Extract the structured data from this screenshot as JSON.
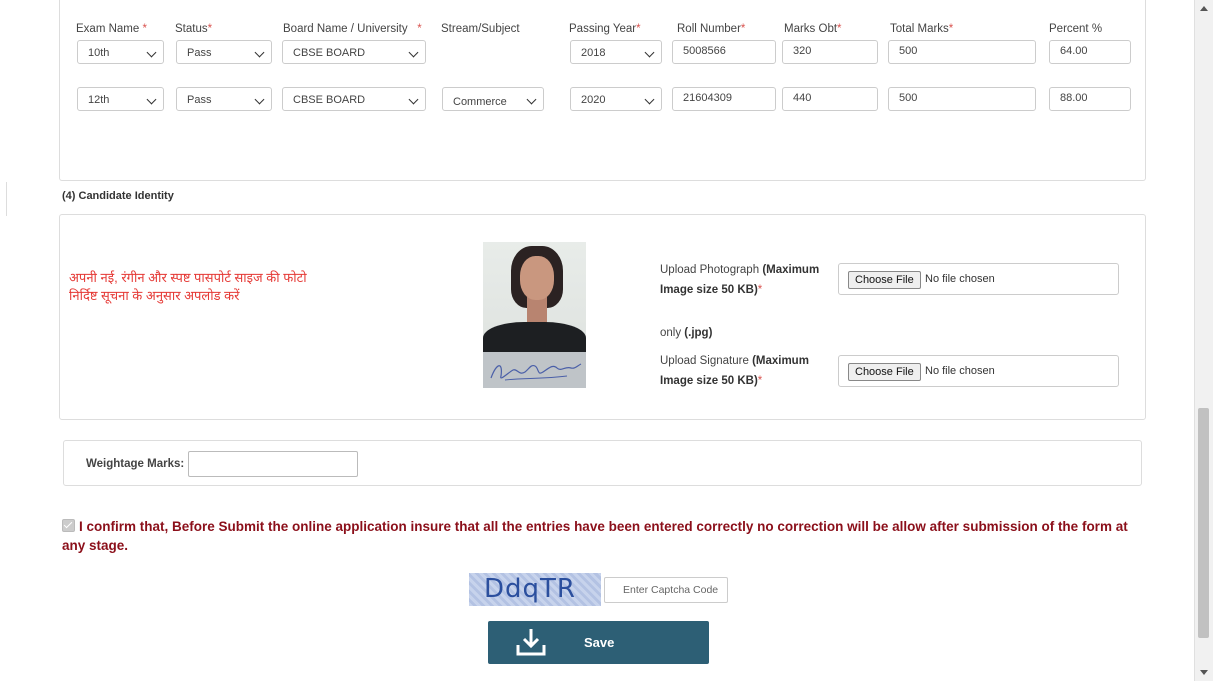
{
  "qualification": {
    "headers": {
      "exam_name": "Exam Name",
      "status": "Status",
      "board": "Board Name / University",
      "stream": "Stream/Subject",
      "passing_year": "Passing Year",
      "roll_number": "Roll Number",
      "marks_obt": "Marks Obt",
      "total_marks": "Total Marks",
      "percent": "Percent %"
    },
    "required_mark": "*",
    "rows": [
      {
        "exam": "10th",
        "status": "Pass",
        "board": "CBSE BOARD",
        "stream": "",
        "year": "2018",
        "roll": "5008566",
        "marks": "320",
        "total": "500",
        "percent": "64.00"
      },
      {
        "exam": "12th",
        "status": "Pass",
        "board": "CBSE BOARD",
        "stream": "Commerce",
        "year": "2020",
        "roll": "21604309",
        "marks": "440",
        "total": "500",
        "percent": "88.00"
      }
    ]
  },
  "identity": {
    "section_title": "(4) Candidate Identity",
    "hindi_line1": "अपनी नई, रंगीन और स्पष्ट पासपोर्ट साइज की फोटो",
    "hindi_line2": "निर्दिष्ट सूचना के अनुसार अपलोड करें",
    "photo_label_normal": "Upload Photograph ",
    "photo_label_bold1": "(Maximum",
    "photo_label_bold2": "Image size 50 KB)",
    "photo_note_normal": "only ",
    "photo_note_bold": "(.jpg)",
    "sig_label_normal": "Upload Signature ",
    "sig_label_bold1": "(Maximum",
    "sig_label_bold2": "Image size 50 KB)",
    "required_mark": "*",
    "choose_file": "Choose File",
    "no_file": "No file chosen"
  },
  "weightage": {
    "label": "Weightage Marks:",
    "value": ""
  },
  "confirm": {
    "text": "I confirm that, Before Submit the online application insure that all the entries have been entered correctly no correction will be allow after submission of the form at any stage."
  },
  "captcha": {
    "code": "DdqTR",
    "placeholder": "Enter Captcha Code"
  },
  "save": {
    "label": "Save"
  },
  "colors": {
    "required": "#d9534f",
    "confirm_text": "#8b0f1a",
    "save_bg": "#2d5f75",
    "hindi": "#e53935"
  },
  "icons": {
    "save": "download-icon",
    "scroll_up": "arrow-up-icon",
    "scroll_down": "arrow-down-icon"
  }
}
